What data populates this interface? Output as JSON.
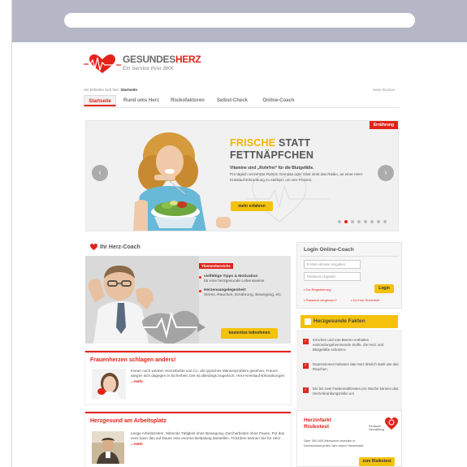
{
  "logo": {
    "main_prefix": "GESUNDES",
    "main_suffix": "HERZ",
    "sub": "Ein Service Ihrer BKK"
  },
  "breadcrumb": {
    "prefix": "Sie befinden sich hier:",
    "current": "Startseite"
  },
  "print_link": "Seite drucken",
  "nav": {
    "items": [
      "Startseite",
      "Rund ums Herz",
      "Risikofaktoren",
      "Selbst-Check",
      "Online-Coach"
    ]
  },
  "hero": {
    "badge": "Ernährung",
    "title_hl": "FRISCHE",
    "title_rest": "STATT",
    "title_line2": "FETTNÄPFCHEN",
    "text_title": "Vitamine sind „Rohrfrei“ für die Blutgefäße.",
    "text_body": "Pro täglich verzehrter Portion Gemüse oder Obst sinkt das Risiko, an einer Herz-Kreislauf-Erkrankung zu sterben, um vier Prozent.",
    "button": "mehr erfahren",
    "arrow_left": "‹",
    "arrow_right": "›",
    "slides": 8,
    "active_slide": 1
  },
  "coach": {
    "heading": "Ihr Herz-Coach",
    "badge": "Themenbereiche",
    "items": [
      {
        "title": "vielfältige Tipps & Motivation",
        "text": "für eine herzgesunde Lebensweise"
      },
      {
        "title": "Herzensangelegenheit:",
        "text": "Stress, Rauchen, Ernährung, Bewegung, etc."
      }
    ],
    "button": "kostenlos teilnehmen"
  },
  "card1": {
    "title": "Frauenherzen schlagen anders!",
    "text": "Immer noch werden Herzinfarkte und Co. als typisches Männerproblem gesehen, Frauen wiegen sich dagegen in Sicherheit. Die ist allerdings trügerisch: Herz-Kreislauf-Erkrankungen",
    "more": "...mehr"
  },
  "card2": {
    "title": "Herzgesund am Arbeitsplatz",
    "text": "Lange Arbeitszeiten, Sitzende Tätigkeit ohne Bewegung, Durcharbeiten ohne Pause. Für das Herz kann das auf Dauer eine enorme Belastung darstellen. Trotzdem können Sie für Herz",
    "more": "...mehr"
  },
  "login": {
    "title": "Login Online-Coach",
    "email_placeholder": "E-Mail-Adresse eingeben",
    "password_placeholder": "Passwort eingeben",
    "register": "Zur Registrierung",
    "forgot": "Passwort vergessen?",
    "safe": "Zu Ihrer Sicherheit",
    "button": "Login"
  },
  "facts": {
    "heading": "Herzgesunde Fakten",
    "items": [
      "Kirschen und rote Beeren enthalten entzündungshemmende Stoffe, die Herz und Blutgefäße schützen.",
      "Depressionen belasten das Herz ähnlich stark wie das Rauchen.",
      "Ein bis zwei Fastenmahlzeiten pro Woche können das Herzerkrankungsrisiko um"
    ]
  },
  "risk": {
    "title_line1": "Herzinfarkt",
    "title_line2": "Risikotest",
    "text": "Über 300.000 Menschen erleiden in Deutschland jedes Jahr einen Herzinfarkt.",
    "button": "zum Risikotest",
    "partner_line1": "Deutsche",
    "partner_line2": "Herzstiftung"
  },
  "colors": {
    "accent": "#e2231a",
    "button": "#f4c20d",
    "browser_chrome": "#b5b7c6"
  }
}
